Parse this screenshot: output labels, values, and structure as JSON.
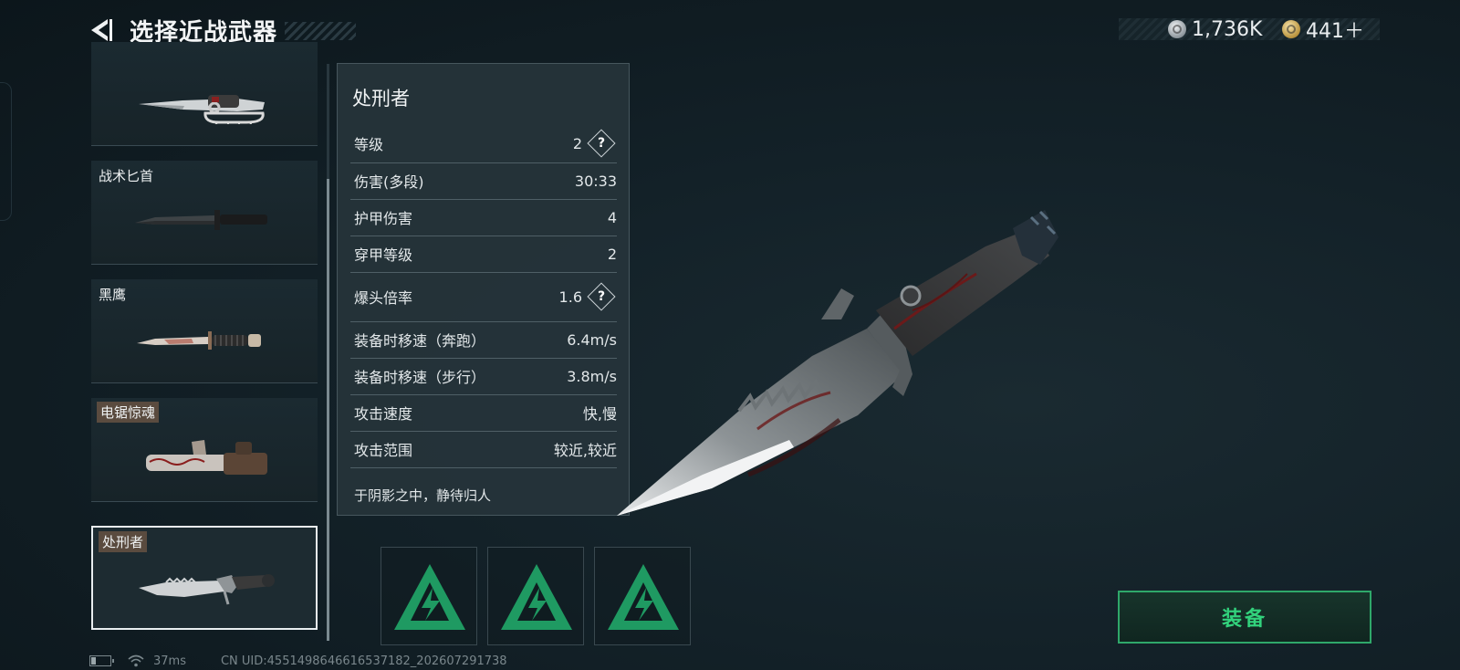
{
  "header": {
    "title": "选择近战武器",
    "currency": [
      {
        "icon": "silver-coin-icon",
        "value": "1,736K"
      },
      {
        "icon": "gold-coin-icon",
        "value": "441＋"
      }
    ]
  },
  "weapons": [
    {
      "name": "",
      "image": "knuckle-knife"
    },
    {
      "name": "战术匕首",
      "image": "tactical-dagger"
    },
    {
      "name": "黑鹰",
      "image": "black-eagle-knife"
    },
    {
      "name": "电锯惊魂",
      "image": "chainsaw"
    },
    {
      "name": "处刑者",
      "image": "executioner-knife",
      "selected": true
    }
  ],
  "stats": {
    "title": "处刑者",
    "rows": [
      {
        "label": "等级",
        "value": "2",
        "help": true
      },
      {
        "label": "伤害(多段)",
        "value": "30:33"
      },
      {
        "label": "护甲伤害",
        "value": "4"
      },
      {
        "label": "穿甲等级",
        "value": "2"
      },
      {
        "label": "爆头倍率",
        "value": "1.6",
        "help": true
      },
      {
        "label": "装备时移速（奔跑）",
        "value": "6.4m/s"
      },
      {
        "label": "装备时移速（步行）",
        "value": "3.8m/s"
      },
      {
        "label": "攻击速度",
        "value": "快,慢"
      },
      {
        "label": "攻击范围",
        "value": "较近,较近"
      }
    ],
    "description": "于阴影之中，静待归人",
    "help_symbol": "?"
  },
  "slots": [
    {
      "icon": "green-triangle-emblem-icon"
    },
    {
      "icon": "green-triangle-emblem-icon"
    },
    {
      "icon": "green-triangle-emblem-icon"
    }
  ],
  "equip_button": "装备",
  "footer": {
    "ping": "37ms",
    "uid": "CN UID:4551498646616537182_202607291738"
  },
  "colors": {
    "accent_green": "#32d27c",
    "background": "#0f1a1f"
  }
}
